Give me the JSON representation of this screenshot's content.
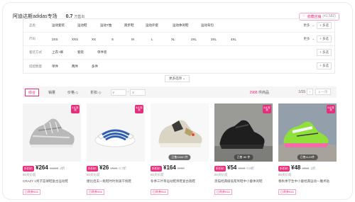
{
  "header": {
    "title": "阿迪达斯adidas专场",
    "sold": "0.7",
    "sold_unit": "万售出",
    "fav_label": "收藏店铺",
    "fav_count": "(41,582)"
  },
  "filters": {
    "more_label": "更多",
    "multi_label": "+ 多选",
    "rows": [
      {
        "label": "品类",
        "options": [
          "运动套装",
          "运动鞋",
          "运动T恤",
          "跑步鞋",
          "运动外套",
          "运动休闲鞋",
          "运动背包"
        ]
      },
      {
        "label": "尺码",
        "options": [
          "3XS",
          "XXS",
          "XS",
          "S",
          "M",
          "L",
          "XL",
          "2XL",
          "3XL",
          "4XL"
        ]
      },
      {
        "label": "着装方式",
        "options": [
          "上衣+裤",
          "套装",
          "单件装"
        ]
      },
      {
        "label": "搭配数量",
        "options": [
          "单件",
          "两件",
          "多件"
        ]
      }
    ],
    "more_filters": "更多选项 ⌄"
  },
  "sortbar": {
    "items": [
      "综合",
      "销量",
      "价格 ◇",
      "折扣 ◇"
    ],
    "price_from": "¥",
    "price_to": "¥",
    "count_num": "2988",
    "count_label": "件商品",
    "page_current": "1",
    "page_total": "/15",
    "prev": "‹",
    "next": "›",
    "jump": "1 一页"
  },
  "products": [
    {
      "badge": "折扣价",
      "price": "¥264",
      "orig": "¥1299",
      "discount": "2折",
      "meta": "80天价前",
      "name": "CRAZY 1男子篮球鞋复古运动鞋",
      "promo": "日贵券¥16",
      "tag": "8.8 特卖",
      "sales": ""
    },
    {
      "badge": "折扣价",
      "price": "¥26",
      "orig": "¥699",
      "discount": "0.7折",
      "meta": "80天价前",
      "name": "捷比佰夫—拖鞋时时尚速干拖鞋",
      "promo": "日贵券¥16",
      "tag": "8.8 特卖",
      "sales": ""
    },
    {
      "badge": "折扣价",
      "price": "¥164",
      "orig": "¥799",
      "discount": "",
      "meta": "80天价前",
      "name": "冬季三叶草运动鞋男鞋复古跑鞋",
      "promo": "日贵券¥16",
      "tag": "",
      "sales": "已售1000+件"
    },
    {
      "badge": "折扣价",
      "price": "¥54",
      "orig": "¥569",
      "discount": "0.9折",
      "meta": "80天价前",
      "name": "黑猫经典级低帮男鞋中小童休闲鞋",
      "promo": "日贵券¥16",
      "tag": "8.8 特卖",
      "sales": "已售 80 件"
    },
    {
      "badge": "折扣价",
      "price": "¥48",
      "orig": "¥399",
      "discount": "1折",
      "meta": "80天价前",
      "name": "春秋季学生中小童经典运动—魔术贴",
      "promo": "日贵券¥16",
      "tag": "8.8 特卖",
      "sales": "已售1123件"
    }
  ]
}
